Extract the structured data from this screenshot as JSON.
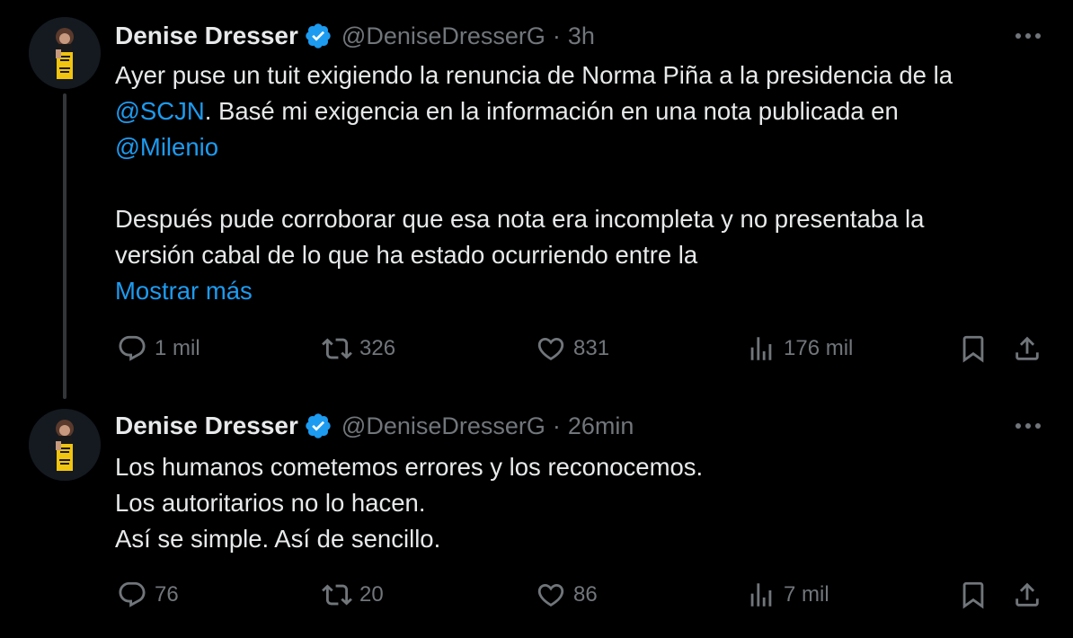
{
  "tweets": [
    {
      "author": {
        "name": "Denise Dresser",
        "handle": "@DeniseDresserG",
        "separator": "·",
        "time": "3h",
        "verified": true
      },
      "text": {
        "line1": "Ayer puse un tuit exigiendo la renuncia de Norma Piña a la presidencia de la",
        "mention1": "@SCJN",
        "line2_rest": ". Basé mi exigencia en la información en una nota publicada en",
        "mention2": "@Milenio",
        "line4": "Después pude corroborar que esa nota era incompleta y no presentaba la",
        "line5": "versión cabal de lo que ha estado ocurriendo entre la",
        "show_more": "Mostrar más"
      },
      "stats": {
        "replies": "1 mil",
        "retweets": "326",
        "likes": "831",
        "views": "176 mil"
      }
    },
    {
      "author": {
        "name": "Denise Dresser",
        "handle": "@DeniseDresserG",
        "separator": "·",
        "time": "26min",
        "verified": true
      },
      "text": {
        "line1": "Los humanos cometemos errores y los reconocemos.",
        "line2": "Los autoritarios no lo hacen.",
        "line3": "Así se simple. Así de sencillo."
      },
      "stats": {
        "replies": "76",
        "retweets": "20",
        "likes": "86",
        "views": "7 mil"
      }
    }
  ],
  "colors": {
    "background": "#000000",
    "text": "#e7e9ea",
    "muted": "#71767b",
    "link": "#1d9bf0",
    "verified": "#1d9bf0",
    "thread_line": "#333639"
  },
  "icons": [
    "verified-badge-icon",
    "more-icon",
    "reply-icon",
    "retweet-icon",
    "like-icon",
    "views-icon",
    "bookmark-icon",
    "share-icon"
  ]
}
